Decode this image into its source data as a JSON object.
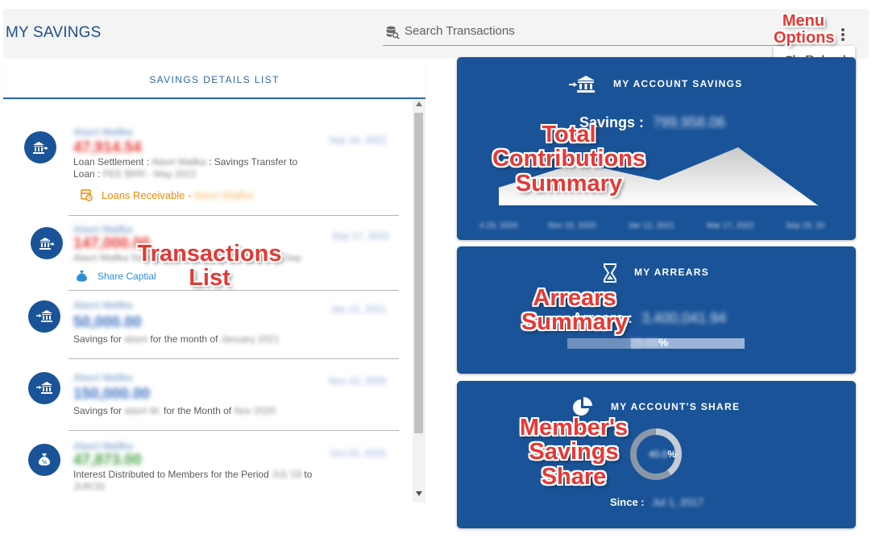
{
  "header": {
    "title": "MY SAVINGS",
    "search_placeholder": "Search Transactions",
    "menu_item_reload": "Reload"
  },
  "savings_list": {
    "title": "SAVINGS DETAILS LIST",
    "items": [
      {
        "name": "Alavri Mallka",
        "date": "Sep 18, 2022",
        "amount": "47,914.54",
        "amount_color": "#e53935",
        "desc_a": "Loan Settlement : ",
        "desc_b": "Alavri Mallka",
        "desc_c": " : Savings Transfer to Loan : ",
        "desc_d": "PEE BRR - May 2022",
        "tag_label": "Loans Receivable - ",
        "tag_sub": "Alavri Mallka",
        "tag_color": "#ef8a00",
        "icon": "bank-transfer-icon"
      },
      {
        "name": "Alavri Mallka",
        "date": "Sep 17, 2022",
        "amount": "147,000.00",
        "amount_color": "#e53935",
        "desc_a": "Alavri Mallka Savings Transfer to Share Captial - ",
        "desc_b": "Sep",
        "desc_c": "",
        "desc_d": "",
        "tag_label": "Share Captial",
        "tag_sub": "",
        "tag_color": "#2d8fd6",
        "icon": "bank-transfer-icon"
      },
      {
        "name": "Alavri Mallka",
        "date": "Jan 12, 2021",
        "amount": "50,000.00",
        "amount_color": "#3a6fc2",
        "desc_a": "Savings for ",
        "desc_b": "alavri",
        "desc_c": " for the month of ",
        "desc_d": "January 2021",
        "tag_label": "",
        "tag_sub": "",
        "tag_color": "#2d8fd6",
        "icon": "bank-deposit-icon"
      },
      {
        "name": "Alavri Mallka",
        "date": "Nov 15, 2020",
        "amount": "150,000.00",
        "amount_color": "#3a6fc2",
        "desc_a": "Savings for ",
        "desc_b": "alavri M.",
        "desc_c": " for the Month of ",
        "desc_d": "Nov 2020",
        "tag_label": "",
        "tag_sub": "",
        "tag_color": "#2d8fd6",
        "icon": "bank-deposit-icon"
      },
      {
        "name": "Alavri Mallka",
        "date": "Oct 03, 2020",
        "amount": "47,873.00",
        "amount_color": "#43a047",
        "desc_a": "Interest Distributed to Members for the Period ",
        "desc_b": "JUL'19",
        "desc_c": " to ",
        "desc_d": "JUN'20",
        "tag_label": "",
        "tag_sub": "",
        "tag_color": "#2d8fd6",
        "icon": "money-bag-icon"
      }
    ]
  },
  "account_savings": {
    "title": "MY ACCOUNT SAVINGS",
    "savings_label": "Savings : ",
    "savings_value": "799,958.06",
    "chart_data": {
      "type": "area",
      "x": [
        "4 23, 2020",
        "Nov 15, 2020",
        "Jan 12, 2021",
        "Mar 17, 2022",
        "Sep 18, 20"
      ],
      "values": [
        20,
        48,
        28,
        65,
        0
      ],
      "color": "#d6d6d6"
    }
  },
  "arrears": {
    "title": "MY ARREARS",
    "arrears_label": "Arrears : ",
    "arrears_value": "3,400,041.94",
    "percent_value": "25.00",
    "percent_sign": "%",
    "progress": 0.36
  },
  "share": {
    "title": "MY ACCOUNT'S SHARE",
    "donut_value": "40.0",
    "donut_sign": "%",
    "donut_fraction": 0.4,
    "since_label": "Since : ",
    "since_value": "Jul 1, 2017"
  },
  "annotations": {
    "menu": "Menu\nOptions",
    "contrib": "Total\nContributions\nSummary",
    "tx": "Transactions\nList",
    "arrears": "Arrears\nSummary",
    "share": "Member's\nSavings\nShare"
  }
}
